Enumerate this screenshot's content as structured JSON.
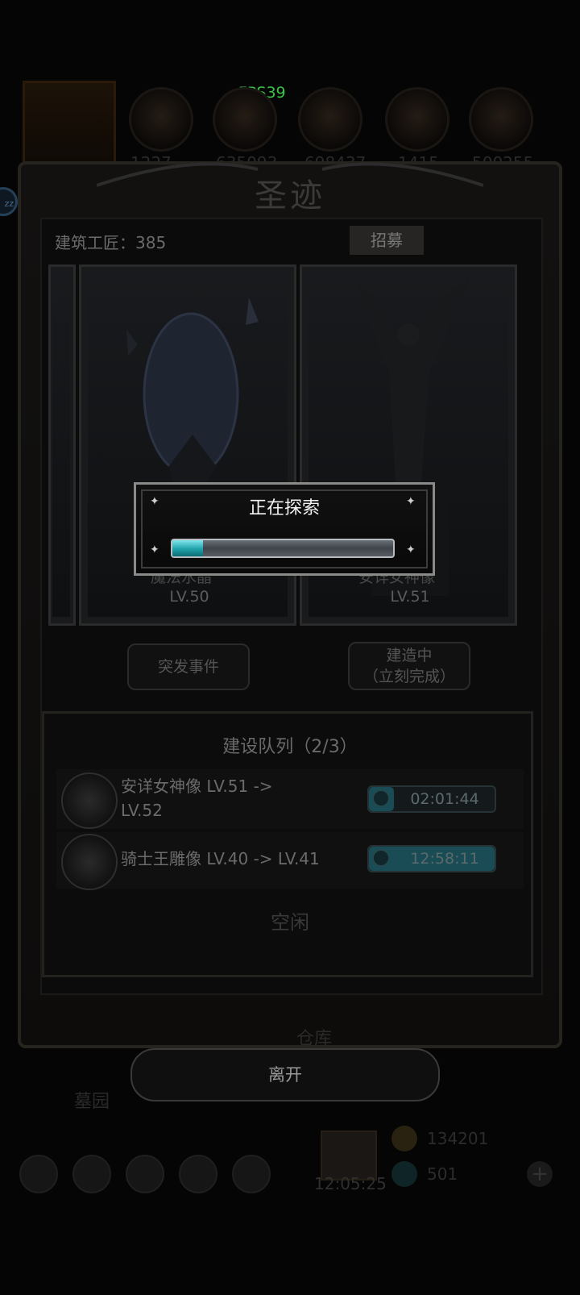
{
  "fps": "FPS39",
  "hud": {
    "zz_badge": "zz",
    "resources": [
      "1227",
      "635093",
      "698437",
      "1415",
      "500255"
    ]
  },
  "panel": {
    "title": "圣迹",
    "workers_label": "建筑工匠：385",
    "recruit_label": "招募",
    "cards": [
      {
        "name": "魔法水晶",
        "level": "LV.50"
      },
      {
        "name": "安详女神像",
        "level": "LV.51"
      }
    ],
    "event_button": "突发事件",
    "building_button_line1": "建造中",
    "building_button_line2": "（立刻完成）"
  },
  "queue": {
    "title": "建设队列（2/3）",
    "items": [
      {
        "text": "安详女神像 LV.51 -> LV.52",
        "timer": "02:01:44",
        "progress": 0.2
      },
      {
        "text": "骑士王雕像 LV.40 -> LV.41",
        "timer": "12:58:11",
        "progress": 1.0
      }
    ],
    "idle_label": "空闲"
  },
  "leave_button": "离开",
  "background": {
    "warehouse_label": "仓库",
    "garden_label": "墓园",
    "time": "12:05:25",
    "gold": "134201",
    "gems": "501"
  },
  "dialog": {
    "title": "正在探索",
    "progress": 0.14
  },
  "colors": {
    "progress_fill": "#1fa1aa",
    "fps_text": "#39c34a"
  }
}
